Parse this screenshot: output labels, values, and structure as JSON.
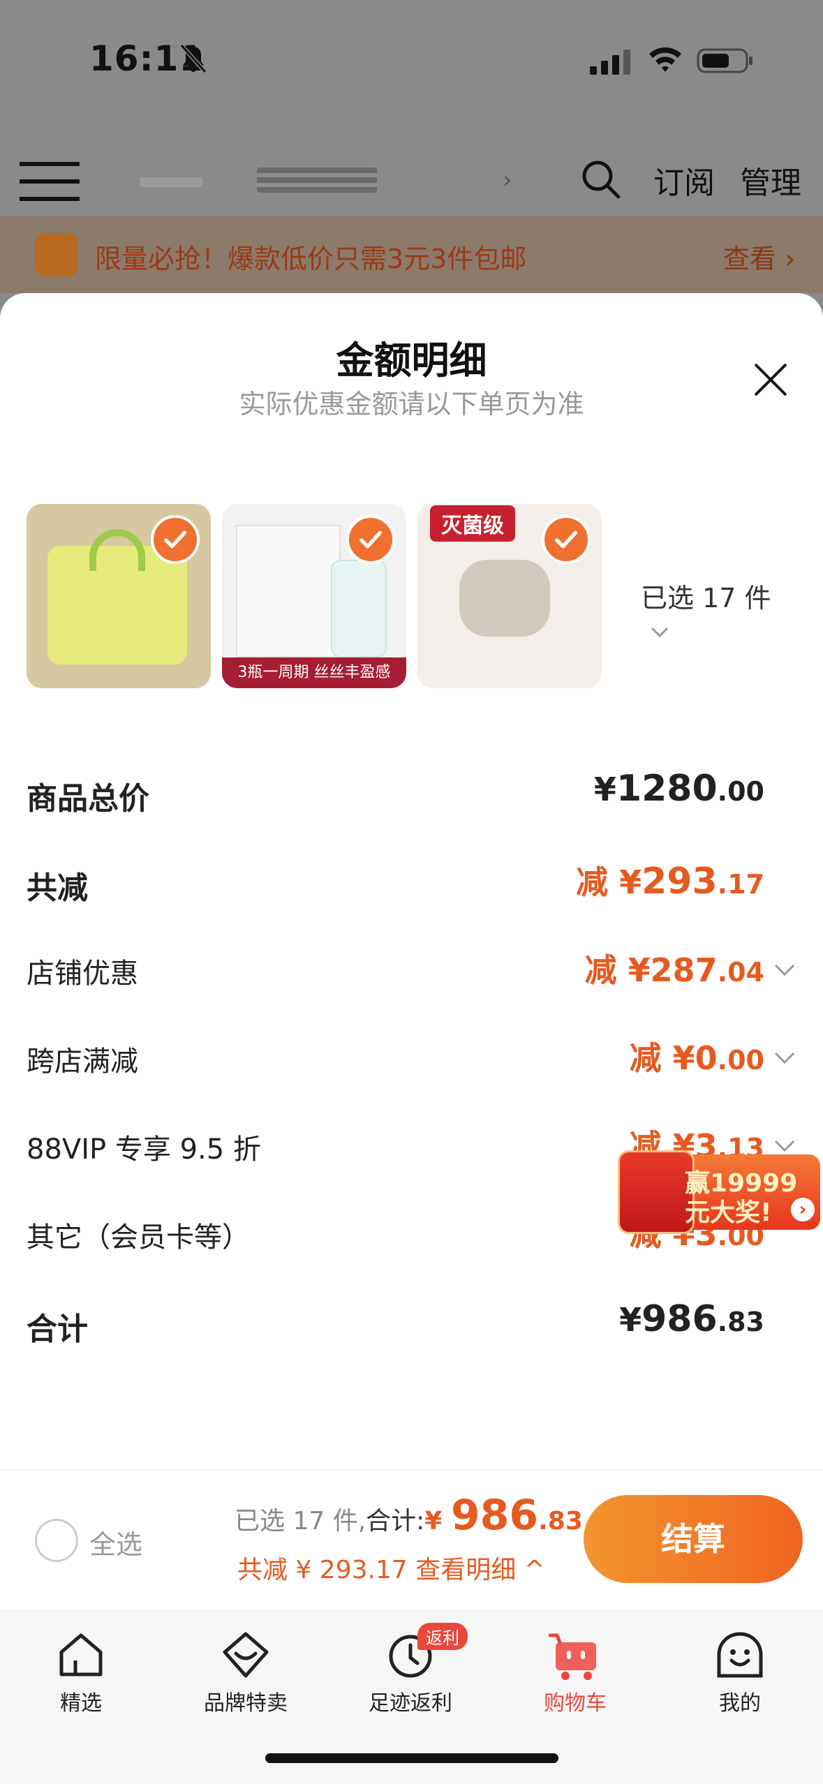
{
  "status_bar": {
    "time": "16:11"
  },
  "nav": {
    "subscribe": "订阅",
    "manage": "管理",
    "chevron": "›"
  },
  "promo": {
    "text": "限量必抢！爆款低价只需3元3件包邮",
    "view": "查看 ›"
  },
  "sheet": {
    "title": "金额明细",
    "subtitle": "实际优惠金额请以下单页为准",
    "selected_count": "已选 17 件",
    "products": [
      {
        "strip": ""
      },
      {
        "strip": "3瓶一周期  丝丝丰盈感"
      },
      {
        "tag": "灭菌级"
      }
    ],
    "rows": [
      {
        "label": "商品总价",
        "prefix": "",
        "yen": "¥",
        "whole": "1280",
        "cents": ".00"
      },
      {
        "label": "共减",
        "prefix": "减 ",
        "yen": "¥",
        "whole": "293",
        "cents": ".17"
      },
      {
        "label": "店铺优惠",
        "prefix": "减 ",
        "yen": "¥",
        "whole": "287",
        "cents": ".04"
      },
      {
        "label": "跨店满减",
        "prefix": "减 ",
        "yen": "¥",
        "whole": "0",
        "cents": ".00"
      },
      {
        "label": "88VIP 专享 9.5 折",
        "prefix": "减 ",
        "yen": "¥",
        "whole": "3",
        "cents": ".13"
      },
      {
        "label": "其它（会员卡等）",
        "prefix": "减 ",
        "yen": "¥",
        "whole": "3",
        "cents": ".00"
      },
      {
        "label": "合计",
        "prefix": "",
        "yen": "¥",
        "whole": "986",
        "cents": ".83"
      }
    ]
  },
  "floating_ad": {
    "line1": "赢19999",
    "line2": "元大奖!",
    "arrow": "›"
  },
  "checkout": {
    "select_all": "全选",
    "selected_prefix": "已选 17 件,",
    "total_label": "合计:",
    "total_yen": "¥ ",
    "total_whole": "986",
    "total_cents": ".83",
    "discount_text": "共减 ¥ 293.17  查看明细 ^",
    "button": "结算"
  },
  "tabs": [
    {
      "label": "精选",
      "icon": "home-icon"
    },
    {
      "label": "品牌特卖",
      "icon": "diamond-icon"
    },
    {
      "label": "足迹返利",
      "icon": "clock-icon",
      "badge": "返利"
    },
    {
      "label": "购物车",
      "icon": "cart-icon",
      "active": true
    },
    {
      "label": "我的",
      "icon": "profile-icon"
    }
  ],
  "colors": {
    "accent": "#e65a1f",
    "checkout_start": "#f39530",
    "checkout_end": "#ef6420",
    "tab_active": "#e8483a"
  }
}
